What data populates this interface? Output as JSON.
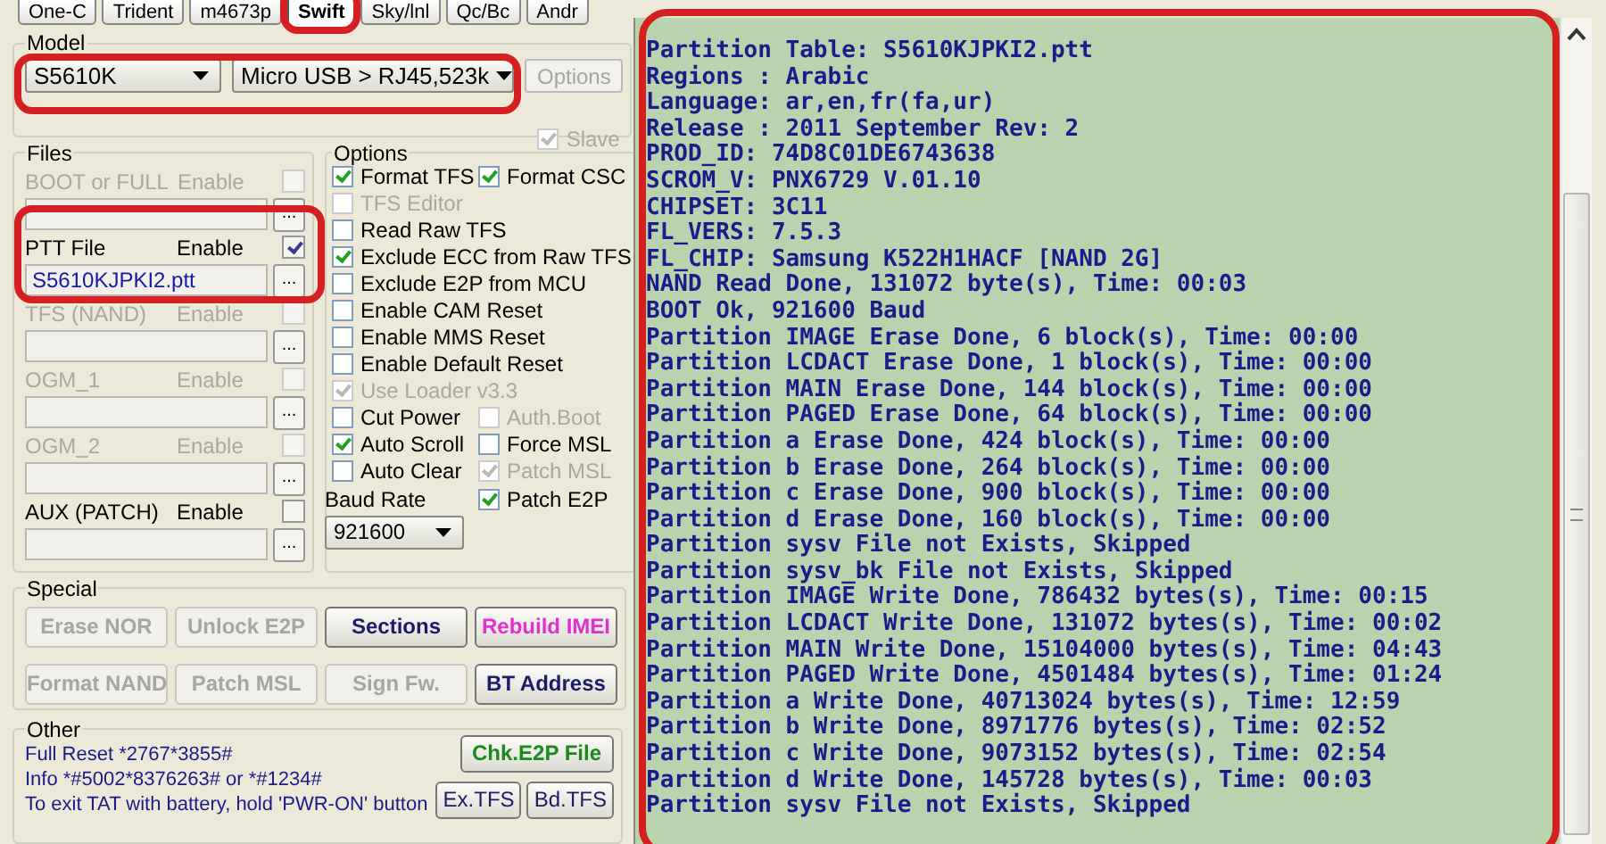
{
  "tabs": [
    {
      "label": "One-C",
      "selected": false
    },
    {
      "label": "Trident",
      "selected": false
    },
    {
      "label": "m4673p",
      "selected": false
    },
    {
      "label": "Swift",
      "selected": true
    },
    {
      "label": "Sky/lnl",
      "selected": false
    },
    {
      "label": "Qc/Bc",
      "selected": false
    },
    {
      "label": "Andr",
      "selected": false
    }
  ],
  "model": {
    "label": "Model",
    "phone": "S5610K",
    "cable": "Micro USB > RJ45,523k",
    "options_button": {
      "label": "Options",
      "disabled": true
    },
    "slave": {
      "label": "Slave",
      "checked": true,
      "disabled": true
    }
  },
  "files": {
    "label": "Files",
    "items": [
      {
        "name": "BOOT or FULL",
        "enable_label": "Enable",
        "checked": false,
        "disabled": true,
        "browse_label": "..."
      },
      {
        "name": "PTT File",
        "enable_label": "Enable",
        "checked": true,
        "disabled": false,
        "value": "S5610KJPKI2.ptt",
        "browse_label": "..."
      },
      {
        "name": "TFS (NAND)",
        "enable_label": "Enable",
        "checked": false,
        "disabled": true,
        "browse_label": "..."
      },
      {
        "name": "OGM_1",
        "enable_label": "Enable",
        "checked": false,
        "disabled": true,
        "browse_label": "..."
      },
      {
        "name": "OGM_2",
        "enable_label": "Enable",
        "checked": false,
        "disabled": true,
        "browse_label": "..."
      },
      {
        "name": "AUX (PATCH)",
        "enable_label": "Enable",
        "checked": false,
        "disabled": false,
        "browse_label": "..."
      }
    ]
  },
  "options": {
    "label": "Options",
    "rows": [
      [
        {
          "kind": "check",
          "label": "Format TFS",
          "checked": true,
          "disabled": false
        },
        {
          "kind": "check",
          "label": "Format CSC",
          "checked": true,
          "disabled": false
        }
      ],
      [
        {
          "kind": "check",
          "label": "TFS Editor",
          "checked": false,
          "disabled": true
        }
      ],
      [
        {
          "kind": "check",
          "label": "Read Raw TFS",
          "checked": false,
          "disabled": false
        }
      ],
      [
        {
          "kind": "check",
          "label": "Exclude ECC from Raw TFS",
          "checked": true,
          "disabled": false
        }
      ],
      [
        {
          "kind": "check",
          "label": "Exclude E2P from MCU",
          "checked": false,
          "disabled": false
        }
      ],
      [
        {
          "kind": "check",
          "label": "Enable CAM Reset",
          "checked": false,
          "disabled": false
        }
      ],
      [
        {
          "kind": "check",
          "label": "Enable MMS Reset",
          "checked": false,
          "disabled": false
        }
      ],
      [
        {
          "kind": "check",
          "label": "Enable Default Reset",
          "checked": false,
          "disabled": false
        }
      ],
      [
        {
          "kind": "check",
          "label": "Use Loader v3.3",
          "checked": true,
          "disabled": true
        }
      ],
      [
        {
          "kind": "check",
          "label": "Cut Power",
          "checked": false,
          "disabled": false
        },
        {
          "kind": "check",
          "label": "Auth.Boot",
          "checked": false,
          "disabled": true
        }
      ],
      [
        {
          "kind": "check",
          "label": "Auto Scroll",
          "checked": true,
          "disabled": false
        },
        {
          "kind": "check",
          "label": "Force MSL",
          "checked": false,
          "disabled": false
        }
      ],
      [
        {
          "kind": "check",
          "label": "Auto Clear",
          "checked": false,
          "disabled": false
        },
        {
          "kind": "check",
          "label": "Patch MSL",
          "checked": true,
          "disabled": true
        }
      ],
      [
        {
          "kind": "baud",
          "label": "Baud Rate",
          "value": "921600"
        },
        {
          "kind": "check",
          "label": "Patch E2P",
          "checked": true,
          "disabled": false
        }
      ]
    ]
  },
  "special": {
    "label": "Special",
    "buttons": [
      {
        "label": "Erase NOR",
        "disabled": true
      },
      {
        "label": "Unlock E2P",
        "disabled": true
      },
      {
        "label": "Sections",
        "disabled": false,
        "color": "#1c1c6a"
      },
      {
        "label": "Rebuild IMEI",
        "disabled": false,
        "color": "#e030d0"
      },
      {
        "label": "Format NAND",
        "disabled": true
      },
      {
        "label": "Patch MSL",
        "disabled": true
      },
      {
        "label": "Sign Fw.",
        "disabled": true
      },
      {
        "label": "BT Address",
        "disabled": false,
        "color": "#1c1c6a"
      }
    ]
  },
  "other": {
    "label": "Other",
    "lines": [
      "Full Reset  *2767*3855#",
      "Info  *#5002*8376263#  or *#1234#",
      "To exit TAT with battery, hold 'PWR-ON' button"
    ],
    "buttons": [
      {
        "label": "Chk.E2P File",
        "color": "#1a8a1a"
      },
      {
        "label": "Ex.TFS",
        "color": "#1c1c6a"
      },
      {
        "label": "Bd.TFS",
        "color": "#1c1c6a"
      }
    ]
  },
  "log": {
    "lines": [
      "Partition Table: S5610KJPKI2.ptt",
      "Regions : Arabic",
      "Language: ar,en,fr(fa,ur)",
      "Release : 2011 September Rev: 2",
      "PROD_ID: 74D8C01DE6743638",
      "SCROM_V: PNX6729 V.01.10",
      "CHIPSET: 3C11",
      "FL_VERS: 7.5.3",
      "FL_CHIP: Samsung K522H1HACF [NAND 2G]",
      "NAND Read Done, 131072 byte(s), Time: 00:03",
      "BOOT Ok, 921600 Baud",
      "Partition IMAGE Erase Done, 6 block(s), Time: 00:00",
      "Partition LCDACT Erase Done, 1 block(s), Time: 00:00",
      "Partition MAIN Erase Done, 144 block(s), Time: 00:00",
      "Partition PAGED Erase Done, 64 block(s), Time: 00:00",
      "Partition a Erase Done, 424 block(s), Time: 00:00",
      "Partition b Erase Done, 264 block(s), Time: 00:00",
      "Partition c Erase Done, 900 block(s), Time: 00:00",
      "Partition d Erase Done, 160 block(s), Time: 00:00",
      "Partition sysv File not Exists, Skipped",
      "Partition sysv_bk File not Exists, Skipped",
      "Partition IMAGE Write Done, 786432 bytes(s), Time: 00:15",
      "Partition LCDACT Write Done, 131072 bytes(s), Time: 00:02",
      "Partition MAIN Write Done, 15104000 bytes(s), Time: 04:43",
      "Partition PAGED Write Done, 4501484 bytes(s), Time: 01:24",
      "Partition a Write Done, 40713024 bytes(s), Time: 12:59",
      "Partition b Write Done, 8971776 bytes(s), Time: 02:52",
      "Partition c Write Done, 9073152 bytes(s), Time: 02:54",
      "Partition d Write Done, 145728 bytes(s), Time: 00:03",
      "Partition sysv File not Exists, Skipped"
    ]
  }
}
